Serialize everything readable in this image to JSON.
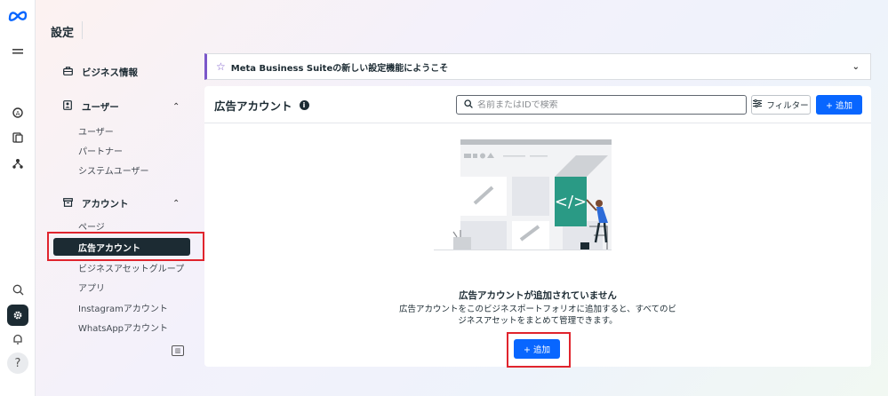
{
  "rail": {
    "logo": "meta-logo",
    "menu_icon": "hamburger-icon",
    "icons": [
      "business-icon",
      "pages-icon",
      "tree-icon"
    ],
    "bottom_icons": [
      "search-icon",
      "gear-icon",
      "bell-icon",
      "help-icon"
    ],
    "help_glyph": "?"
  },
  "header": {
    "title": "設定"
  },
  "sidebar": {
    "business_info": "ビジネス情報",
    "users_section": {
      "label": "ユーザー",
      "items": [
        "ユーザー",
        "パートナー",
        "システムユーザー"
      ]
    },
    "accounts_section": {
      "label": "アカウント",
      "items": [
        "ページ",
        "広告アカウント",
        "ビジネスアセットグループ",
        "アプリ",
        "Instagramアカウント",
        "WhatsAppアカウント"
      ],
      "selected": "広告アカウント"
    }
  },
  "banner": {
    "text": "Meta Business Suiteの新しい設定機能にようこそ"
  },
  "panel": {
    "title": "広告アカウント",
    "search_placeholder": "名前またはIDで検索",
    "filter_label": "フィルター",
    "add_label": "+ 追加"
  },
  "empty_state": {
    "title": "広告アカウントが追加されていません",
    "description": "広告アカウントをこのビジネスポートフォリオに追加すると、すべてのビジネスアセットをまとめて管理できます。",
    "add_label": "+ 追加"
  },
  "colors": {
    "accent": "#0866ff",
    "highlight": "#e0242d",
    "banner_accent": "#7b57c9",
    "selected_bg": "#1c2b33"
  }
}
